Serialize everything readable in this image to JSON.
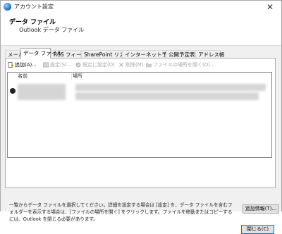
{
  "window": {
    "title": "アカウント設定"
  },
  "header": {
    "title": "データ ファイル",
    "subtitle": "Outlook データ ファイル"
  },
  "tabs": [
    {
      "label": "メール",
      "active": false
    },
    {
      "label": "データ ファイル",
      "active": true
    },
    {
      "label": "RSS フィード",
      "active": false
    },
    {
      "label": "SharePoint リスト",
      "active": false
    },
    {
      "label": "インターネット予定表",
      "active": false
    },
    {
      "label": "公開予定表",
      "active": false
    },
    {
      "label": "アドレス帳",
      "active": false
    }
  ],
  "toolbar": {
    "add": "追加(A)...",
    "settings": "設定(S)...",
    "set_default": "既定に設定(D)",
    "remove": "削除(M)",
    "open_location": "ファイルの場所を開く(O)..."
  },
  "list": {
    "col_name": "名前",
    "col_location": "場所"
  },
  "description": "一覧からデータ ファイルを選択してください。詳細を設定する場合は [設定] を、データ ファイルを含むフォルダーを表示する場合は、[ファイルの場所を開く] をクリックします。ファイルを移動またはコピーするには、Outlook を閉じる必要があります。",
  "buttons": {
    "account_info": "追加情報(T)...",
    "close": "閉じる(C)"
  },
  "icons": {
    "app": "outlook-globe-icon",
    "add": "add-file-icon",
    "settings": "settings-icon",
    "default": "check-circle-icon",
    "remove": "remove-x-icon",
    "folder": "folder-icon"
  }
}
